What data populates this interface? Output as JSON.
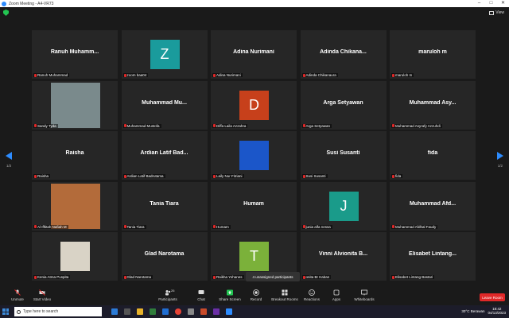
{
  "window": {
    "title": "Zoom Meeting - A4-VR73"
  },
  "topbar": {
    "view_label": "View"
  },
  "pagination": {
    "left": "1/2",
    "right": "1/2"
  },
  "tiles": [
    {
      "big": "Ranuh  Muhamm...",
      "label": "Ranuh Muhammad",
      "type": "name"
    },
    {
      "big": "Z",
      "label": "zoom baa04",
      "type": "avatar",
      "color": "#1a9b9c"
    },
    {
      "big": "Adina Nurimani",
      "label": "Adina Nurimani",
      "type": "name"
    },
    {
      "big": "Adinda  Chikana...",
      "label": "Adinda Chikanaura",
      "type": "name"
    },
    {
      "big": "maruloh m",
      "label": "maruloh m",
      "type": "name"
    },
    {
      "big": "",
      "label": "Sandy Tyda",
      "type": "photo",
      "color": "#7a8a8c"
    },
    {
      "big": "Muhammad  Mu...",
      "label": "Muhammad Mustofa",
      "type": "name"
    },
    {
      "big": "D",
      "label": "Diffa Laila Azzahra",
      "type": "avatar",
      "color": "#c7401b"
    },
    {
      "big": "Arga Setyawan",
      "label": "Arga Setyawan",
      "type": "name"
    },
    {
      "big": "Muhammad  Asy...",
      "label": "Muhammad Asyrafy Azzuhdi",
      "type": "name"
    },
    {
      "big": "Raisha",
      "label": "Raisha",
      "type": "name"
    },
    {
      "big": "Ardian Latif Bad...",
      "label": "Ardian Latif Badrutama",
      "type": "name"
    },
    {
      "big": "",
      "label": "Laily Nur Fitriani",
      "type": "photo-small",
      "color": "#1b56c9"
    },
    {
      "big": "Susi Susanti",
      "label": "Susi Susanti",
      "type": "name"
    },
    {
      "big": "fida",
      "label": "fida",
      "type": "name"
    },
    {
      "big": "",
      "label": "Al Ifftitah Nafiah M",
      "type": "photo",
      "color": "#b36b3a"
    },
    {
      "big": "Tania Tiara",
      "label": "Tania Tiara",
      "type": "name"
    },
    {
      "big": "Humam",
      "label": "Humam",
      "type": "name"
    },
    {
      "big": "J",
      "label": "junia alfa nessa",
      "type": "avatar",
      "color": "#1a9b8a"
    },
    {
      "big": "Muhammad  Afd...",
      "label": "Muhammad Afdhal Faudy",
      "type": "name"
    },
    {
      "big": "",
      "label": "Kenia Atma Puspita",
      "type": "photo-small",
      "color": "#d9d3c6"
    },
    {
      "big": "Glad Narotama",
      "label": "Glad Narotama",
      "type": "name"
    },
    {
      "big": "T",
      "label": "Raikha Yohanes",
      "type": "avatar",
      "color": "#7bb13a"
    },
    {
      "big": "Vinni  Alvionita  B...",
      "label": "onita Br Kaban",
      "type": "name"
    },
    {
      "big": "Elisabet  Lintang...",
      "label": "Elisabet Lintang Bastari",
      "type": "name"
    }
  ],
  "tooltip": "4 unassigned participants",
  "toolbar": {
    "unmute": "Unmute",
    "start_video": "Start Video",
    "participants": "Participants",
    "participants_count": "26",
    "chat": "Chat",
    "share": "Share Screen",
    "record": "Record",
    "breakout": "Breakout Rooms",
    "reactions": "Reactions",
    "apps": "Apps",
    "whiteboards": "Whiteboards",
    "leave": "Leave Room"
  },
  "taskbar": {
    "search_placeholder": "Type here to search",
    "weather": "30°C  Berawan",
    "time": "18:42",
    "date": "04/13/2023"
  },
  "colors": {
    "accent": "#2d8cff",
    "leave": "#e02828",
    "share": "#23c552"
  }
}
